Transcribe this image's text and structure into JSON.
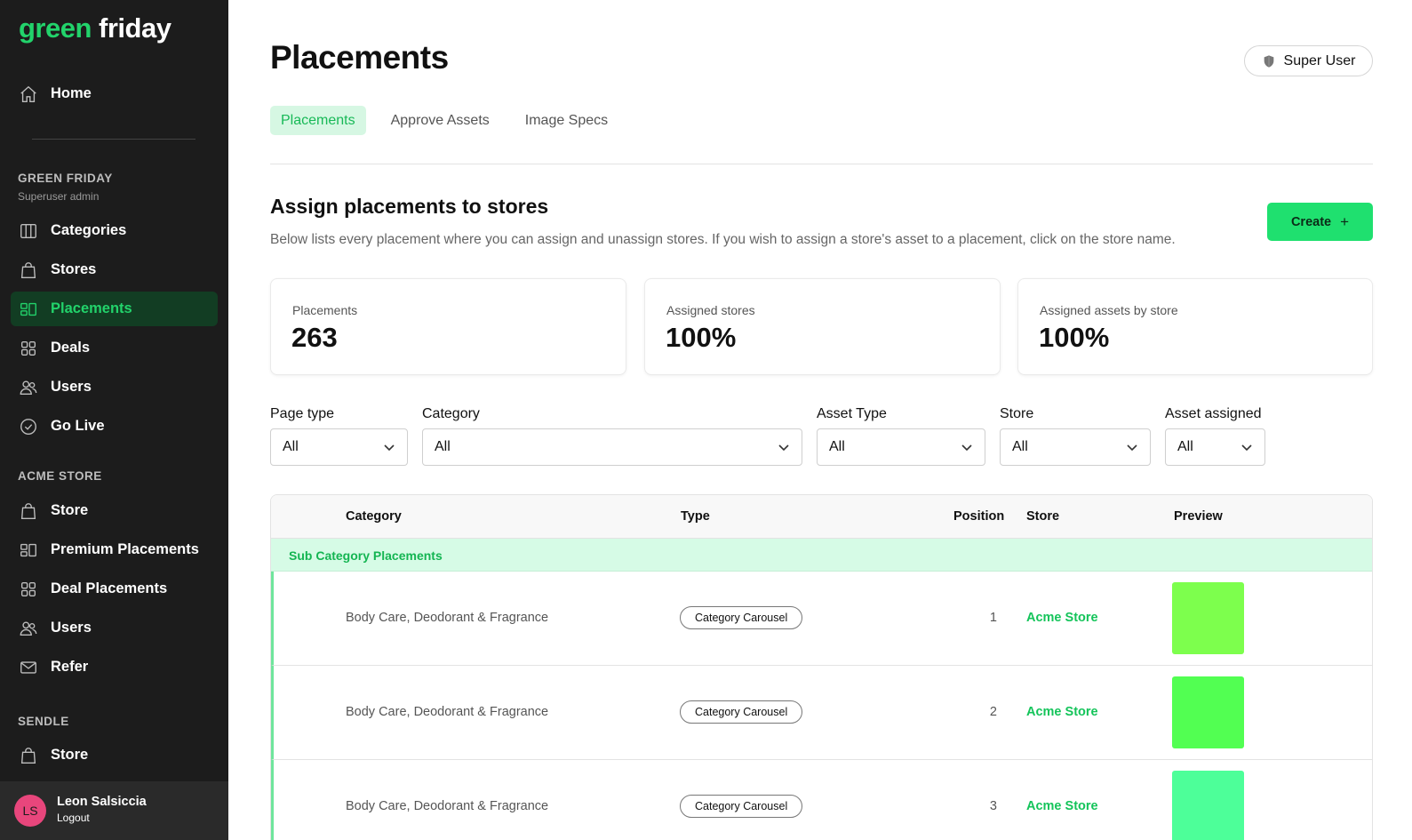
{
  "brand": {
    "logo_part1": "green",
    "logo_part2": "friday"
  },
  "sidebar": {
    "home": "Home",
    "section1": {
      "title": "GREEN FRIDAY",
      "subtitle": "Superuser admin"
    },
    "items1": [
      {
        "label": "Categories",
        "icon": "columns-icon"
      },
      {
        "label": "Stores",
        "icon": "shopping-bag-icon"
      },
      {
        "label": "Placements",
        "icon": "placements-icon",
        "active": true
      },
      {
        "label": "Deals",
        "icon": "grid-icon"
      },
      {
        "label": "Users",
        "icon": "users-icon"
      },
      {
        "label": "Go Live",
        "icon": "check-badge-icon"
      }
    ],
    "section2": {
      "title": "ACME STORE"
    },
    "items2": [
      {
        "label": "Store",
        "icon": "shopping-bag-icon"
      },
      {
        "label": "Premium Placements",
        "icon": "placements-icon"
      },
      {
        "label": "Deal Placements",
        "icon": "grid-icon"
      },
      {
        "label": "Users",
        "icon": "users-icon"
      },
      {
        "label": "Refer",
        "icon": "mail-icon"
      }
    ],
    "section3": {
      "title": "SENDLE"
    },
    "items3": [
      {
        "label": "Store",
        "icon": "shopping-bag-icon"
      }
    ],
    "user": {
      "initials": "LS",
      "name": "Leon Salsiccia",
      "logout": "Logout"
    }
  },
  "header": {
    "title": "Placements",
    "role_badge": "Super User",
    "tabs": [
      {
        "label": "Placements",
        "active": true
      },
      {
        "label": "Approve Assets"
      },
      {
        "label": "Image Specs"
      }
    ]
  },
  "section": {
    "title": "Assign placements to stores",
    "description": "Below lists every placement where you can assign and unassign stores. If you wish to assign a store's asset to a placement, click on the store name.",
    "create_label": "Create",
    "create_symbol": "+"
  },
  "stats": [
    {
      "label": "Placements",
      "value": "263"
    },
    {
      "label": "Assigned stores",
      "value": "100%"
    },
    {
      "label": "Assigned assets by store",
      "value": "100%"
    }
  ],
  "filters": [
    {
      "label": "Page type",
      "value": "All"
    },
    {
      "label": "Category",
      "value": "All"
    },
    {
      "label": "Asset Type",
      "value": "All"
    },
    {
      "label": "Store",
      "value": "All"
    },
    {
      "label": "Asset assigned",
      "value": "All"
    }
  ],
  "table": {
    "columns": [
      "Category",
      "Type",
      "Position",
      "Store",
      "Preview"
    ],
    "group_label": "Sub Category Placements",
    "rows": [
      {
        "category": "Body Care, Deodorant & Fragrance",
        "type": "Category Carousel",
        "position": "1",
        "store": "Acme Store",
        "preview_color": "#7dff4d"
      },
      {
        "category": "Body Care, Deodorant & Fragrance",
        "type": "Category Carousel",
        "position": "2",
        "store": "Acme Store",
        "preview_color": "#52ff52"
      },
      {
        "category": "Body Care, Deodorant & Fragrance",
        "type": "Category Carousel",
        "position": "3",
        "store": "Acme Store",
        "preview_color": "#4dff99"
      }
    ]
  },
  "colors": {
    "accent": "#22d36b",
    "sidebar_bg": "#1c1c1c",
    "active_bg": "#123d23"
  }
}
